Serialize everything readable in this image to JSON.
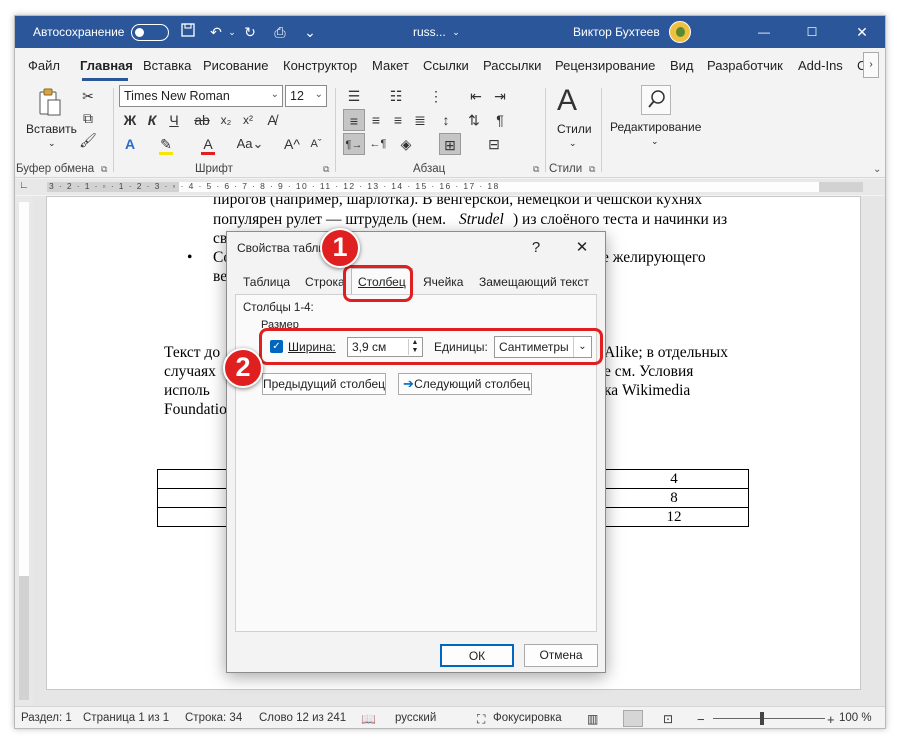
{
  "titlebar": {
    "autosave_label": "Автосохранение",
    "doc_name": "russ...",
    "user_name": "Виктор Бухтеев"
  },
  "ribbon_tabs": [
    "Файл",
    "Главная",
    "Вставка",
    "Рисование",
    "Конструктор",
    "Макет",
    "Ссылки",
    "Рассылки",
    "Рецензирование",
    "Вид",
    "Разработчик",
    "Add-Ins",
    "С"
  ],
  "ribbon": {
    "paste_label": "Вставить",
    "font_name": "Times New Roman",
    "font_size": "12",
    "styles_label": "Стили",
    "editing_label": "Редактирование",
    "groups": [
      "Буфер обмена",
      "Шрифт",
      "Абзац",
      "Стили"
    ]
  },
  "document": {
    "lines": [
      "пирогов (например, шарлотка). В венгерской, немецкой и чешской кухнях",
      "популярен рулет — штрудель (нем.",
      "Strudel",
      ") из слоёного теста и начинки из",
      "св",
      "Со",
      "е желирующего",
      "ве",
      "Текст до",
      "Alike; в отдельных",
      "случаях",
      "е см. Условия",
      "исполь",
      "ка Wikimedia",
      "Foundatio"
    ],
    "table_values": [
      "4",
      "8",
      "12"
    ]
  },
  "dialog": {
    "title": "Свойства табли",
    "help": "?",
    "tabs": [
      "Таблица",
      "Строка",
      "Столбец",
      "Ячейка",
      "Замещающий текст"
    ],
    "columns_label": "Столбцы 1-4:",
    "size_label": "Размер",
    "width_label": "Ширина:",
    "width_value": "3,9 см",
    "units_label": "Единицы:",
    "units_value": "Сантиметры",
    "prev_button": "Предыдущий столбец",
    "next_button": "Следующий столбец",
    "ok_button": "ОК",
    "cancel_button": "Отмена"
  },
  "annotations": [
    "1",
    "2"
  ],
  "statusbar": {
    "section": "Раздел: 1",
    "page": "Страница 1 из 1",
    "line": "Строка: 34",
    "word": "Слово 12 из 241",
    "language": "русский",
    "focus": "Фокусировка",
    "zoom": "100 %"
  },
  "colors": {
    "titlebar": "#2b579a",
    "highlight": "#e02020",
    "accent": "#0067c0"
  }
}
